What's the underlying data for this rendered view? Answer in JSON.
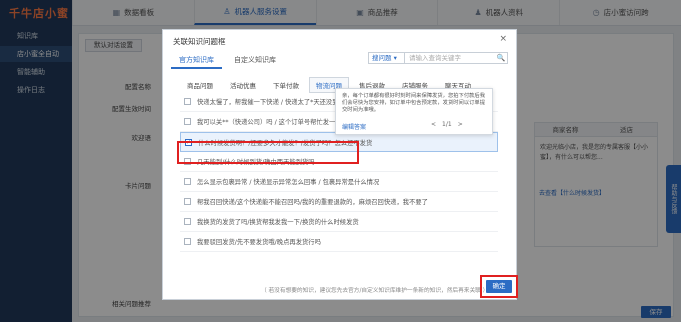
{
  "sidebar": {
    "logo": "千牛店小蜜",
    "items": [
      {
        "label": "知识库"
      },
      {
        "label": "店小蜜全自动"
      },
      {
        "label": "智能辅助"
      },
      {
        "label": "操作日志"
      }
    ]
  },
  "topnav": {
    "tabs": [
      {
        "label": "数据看板",
        "icon": "dashboard-icon"
      },
      {
        "label": "机器人服务设置",
        "icon": "robot-icon"
      },
      {
        "label": "商品推荐",
        "icon": "gift-icon"
      },
      {
        "label": "机器人资料",
        "icon": "user-icon"
      },
      {
        "label": "店小蜜访问跨",
        "icon": "clock-icon"
      }
    ]
  },
  "main": {
    "subtab": "默认对话设置",
    "labels": [
      "配置名称",
      "配置生效时间",
      "欢迎语",
      "卡片问题",
      "相关问题推荐"
    ],
    "right_header": [
      "商家名称",
      "适店"
    ],
    "right_text": "欢迎光临小店，我是您的专属客服【小小蜜】，有什么可以帮您...",
    "right_link": "去查看【什么时候发货】",
    "save": "保存",
    "side_float": "帮助与反馈"
  },
  "modal": {
    "title": "关联知识问题框",
    "close": "×",
    "tabs": [
      {
        "label": "官方知识库",
        "active": true
      },
      {
        "label": "自定义知识库",
        "active": false
      }
    ],
    "search": {
      "select": "搜问题",
      "placeholder": "请输入查询关键字",
      "button": "🔍"
    },
    "categories": [
      {
        "label": "商品问题",
        "active": false
      },
      {
        "label": "活动优惠",
        "active": false
      },
      {
        "label": "下单付款",
        "active": false
      },
      {
        "label": "物流问题",
        "active": true
      },
      {
        "label": "售后退款",
        "active": false
      },
      {
        "label": "店铺服务",
        "active": false
      },
      {
        "label": "聊天互动",
        "active": false
      }
    ],
    "questions": [
      {
        "text": "快递太慢了，帮我催一下快递 / 快递太了*天还没到了/帮我查一下物流",
        "selected": false
      },
      {
        "text": "我可以关**（快递公司）吗 / 这个订单号帮忙发一下（快递公司）",
        "selected": false
      },
      {
        "text": "什么时候发货啊？/还要多久才能发？/发货了吗？怎么还不发货",
        "selected": true
      },
      {
        "text": "几天能到/什么时候到货/确由两天能到货吗",
        "selected": false
      },
      {
        "text": "怎么显示包裹异常 / 快递显示异常怎么回事 / 包裹异常是什么情况",
        "selected": false
      },
      {
        "text": "帮我召回快递/这个快递能不能召回吗/我的的重要退款的，麻烦召回快递，我不要了",
        "selected": false
      },
      {
        "text": "我换货的发货了吗/换货帮我发我一下/换货的什么时候发货",
        "selected": false
      },
      {
        "text": "我要驳回发货/先不要发货哦/晚点再发货行吗",
        "selected": false
      }
    ],
    "popup": {
      "text": "亲，每个订单都有很好时刻时间来保障发货，您拍下付款后我们会尽快为您安排，如订单中包含预定款，发货时间以订单提交时间为准哦。",
      "edit": "编辑答案",
      "prev": "<",
      "page": "1/1",
      "next": ">"
    },
    "footer_note": "（ 若没有想要的知识，建议您先去官方/自定义知识库维护一条新的知识，然后再来关联 ）",
    "ok": "确定"
  }
}
